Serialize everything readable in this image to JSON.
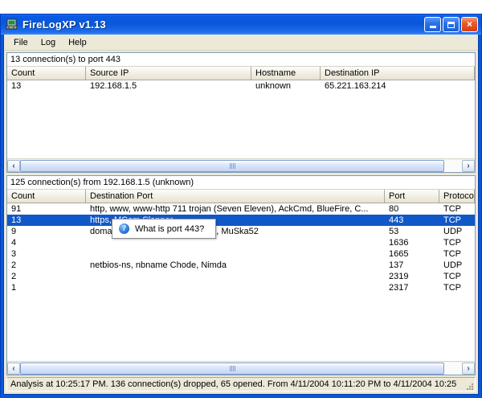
{
  "window": {
    "title": "FireLogXP v1.13",
    "icon": "computer-icon",
    "buttons": {
      "minimize": "_",
      "maximize": "□",
      "close": "×"
    }
  },
  "menu": {
    "items": [
      "File",
      "Log",
      "Help"
    ]
  },
  "top_panel": {
    "caption": "13 connection(s) to port 443",
    "columns": [
      "Count",
      "Source IP",
      "Hostname",
      "Destination IP"
    ],
    "rows": [
      {
        "count": "13",
        "source_ip": "192.168.1.5",
        "hostname": "unknown",
        "destination_ip": "65.221.163.214"
      }
    ],
    "scrollbar": {
      "left_arrow": "‹",
      "right_arrow": "›"
    }
  },
  "bottom_panel": {
    "caption": "125 connection(s) from 192.168.1.5 (unknown)",
    "columns": [
      "Count",
      "Destination Port",
      "Port",
      "Protocol"
    ],
    "rows": [
      {
        "count": "91",
        "destination_port": "http, www, www-http 711 trojan (Seven Eleven), AckCmd, BlueFire, C...",
        "port": "80",
        "protocol": "TCP",
        "selected": false
      },
      {
        "count": "13",
        "destination_port": "https, MCom Slapper",
        "port": "443",
        "protocol": "TCP",
        "selected": true
      },
      {
        "count": "9",
        "destination_port": "domain, ADM Worm, Lion Worm, MuSka52",
        "port": "53",
        "protocol": "UDP",
        "selected": false
      },
      {
        "count": "4",
        "destination_port": "",
        "port": "1636",
        "protocol": "TCP",
        "selected": false
      },
      {
        "count": "3",
        "destination_port": "",
        "port": "1665",
        "protocol": "TCP",
        "selected": false
      },
      {
        "count": "2",
        "destination_port": "netbios-ns, nbname Chode, Nimda",
        "port": "137",
        "protocol": "UDP",
        "selected": false
      },
      {
        "count": "2",
        "destination_port": "",
        "port": "2319",
        "protocol": "TCP",
        "selected": false
      },
      {
        "count": "1",
        "destination_port": "",
        "port": "2317",
        "protocol": "TCP",
        "selected": false
      }
    ],
    "scrollbar": {
      "left_arrow": "‹",
      "right_arrow": "›"
    }
  },
  "tooltip": {
    "text": "What is port 443?",
    "icon": "help-question-icon",
    "icon_glyph": "?"
  },
  "statusbar": {
    "text": "Analysis at 10:25:17 PM. 136 connection(s) dropped, 65 opened. From 4/11/2004 10:11:20 PM to 4/11/2004 10:25"
  },
  "colors": {
    "titlebar": "#0a57d8",
    "selection": "#1058c8",
    "client": "#ece9d8",
    "panel_border": "#7f9db9"
  }
}
